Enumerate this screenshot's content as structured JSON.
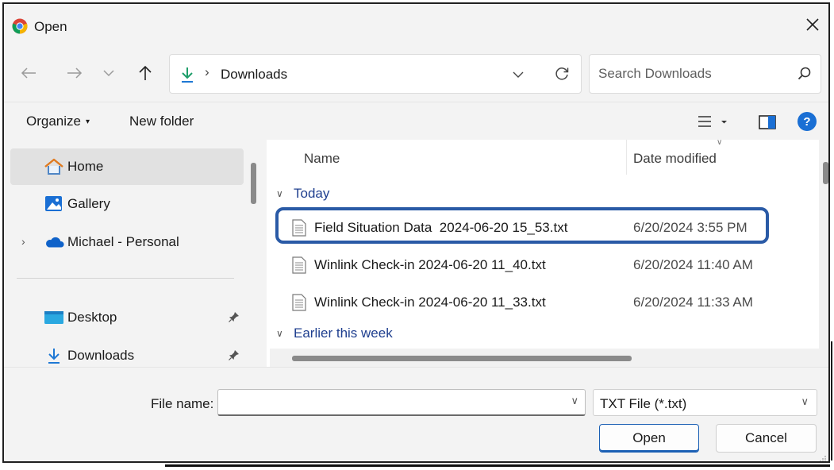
{
  "window": {
    "title": "Open",
    "close_glyph": "✕"
  },
  "nav": {
    "back_glyph": "←",
    "forward_glyph": "→",
    "recent_glyph": "∨",
    "up_glyph": "↑",
    "breadcrumb_sep": "›",
    "location": "Downloads",
    "search_placeholder": "Search Downloads"
  },
  "toolbar": {
    "organize": "Organize",
    "organize_caret": "▾",
    "new_folder": "New folder",
    "help_glyph": "?"
  },
  "sidebar": {
    "items": [
      {
        "label": "Home",
        "icon": "home-icon",
        "selected": true
      },
      {
        "label": "Gallery",
        "icon": "gallery-icon"
      },
      {
        "label": "Michael - Personal",
        "icon": "onedrive-cloud-icon",
        "expand_glyph": "›"
      },
      {
        "label": "Desktop",
        "icon": "desktop-folder-icon",
        "pinned": true
      },
      {
        "label": "Downloads",
        "icon": "download-icon",
        "pinned": true
      }
    ]
  },
  "file_list": {
    "columns": {
      "name": "Name",
      "date": "Date modified"
    },
    "sort_glyph": "∨",
    "group_glyph": "∨",
    "groups": [
      {
        "label": "Today",
        "files": [
          {
            "name": "Field Situation Data  2024-06-20 15_53.txt",
            "date": "6/20/2024 3:55 PM",
            "highlighted": true
          },
          {
            "name": "Winlink Check-in 2024-06-20 11_40.txt",
            "date": "6/20/2024 11:40 AM"
          },
          {
            "name": "Winlink Check-in 2024-06-20 11_33.txt",
            "date": "6/20/2024 11:33 AM"
          }
        ]
      },
      {
        "label": "Earlier this week",
        "files": []
      }
    ]
  },
  "footer": {
    "file_name_label": "File name:",
    "file_name_value": "",
    "dropdown_glyph": "∨",
    "file_type": "TXT File (*.txt)",
    "open_button": "Open",
    "cancel_button": "Cancel"
  },
  "colors": {
    "highlight_border": "#2a5aa6",
    "accent": "#1a6fd4",
    "group_text": "#1f3f8f"
  }
}
